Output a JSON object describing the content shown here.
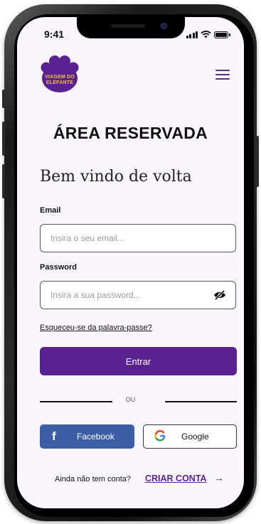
{
  "status_bar": {
    "time": "9:41"
  },
  "header": {
    "logo_text": "VIAGEM DO\nELEFANTE",
    "menu_icon": "hamburger-menu-icon"
  },
  "page": {
    "title": "ÁREA RESERVADA",
    "welcome": "Bem vindo de volta"
  },
  "form": {
    "email_label": "Email",
    "email_placeholder": "Insira o seu email...",
    "password_label": "Password",
    "password_placeholder": "Insira a sua password...",
    "password_toggle_icon": "eye-slash-icon",
    "forgot_link": "Esqueceu-se da palavra-passe?",
    "submit_label": "Entrar"
  },
  "divider_text": "OU",
  "social": {
    "facebook_label": "Facebook",
    "facebook_icon": "facebook-icon",
    "google_label": "Google",
    "google_icon": "google-icon"
  },
  "signup": {
    "question": "Ainda não tem conta?",
    "link": "CRIAR CONTA",
    "arrow_icon": "arrow-right-icon"
  },
  "colors": {
    "brand_purple": "#5a2192",
    "logo_yellow": "#f2c230",
    "facebook_blue": "#3b5ea6",
    "screen_background": "#f8f6fb"
  }
}
